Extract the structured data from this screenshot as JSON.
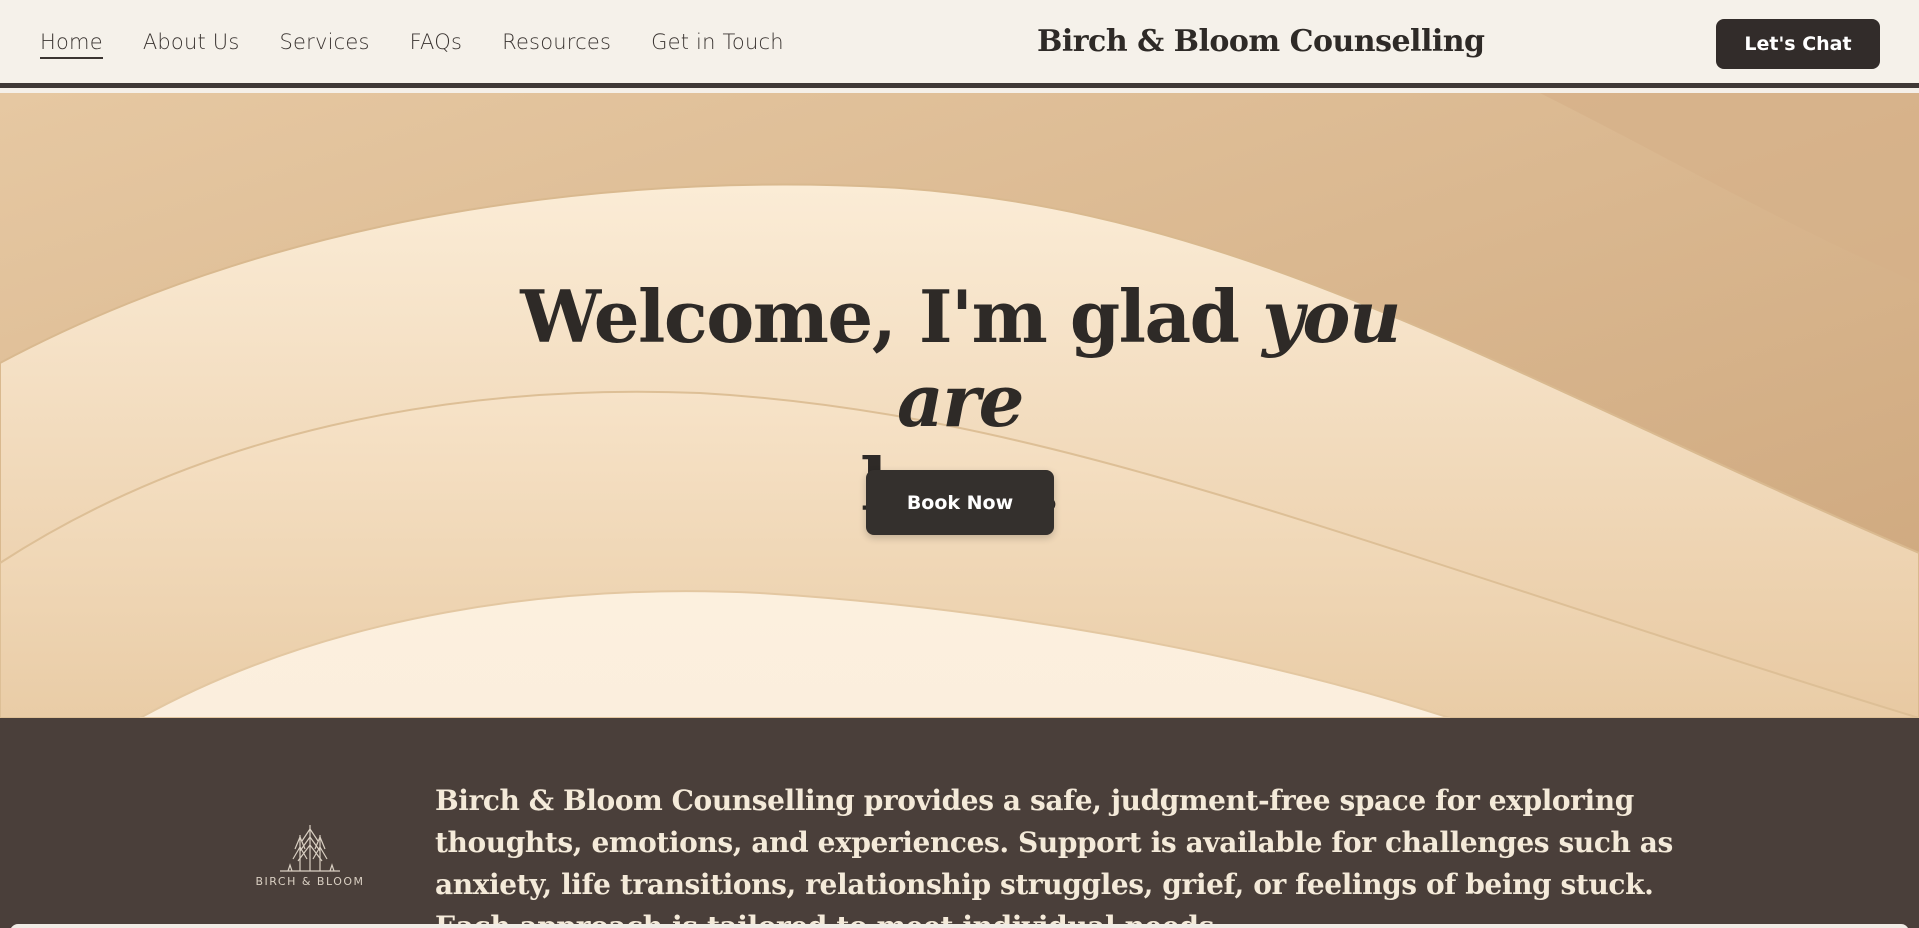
{
  "header": {
    "nav": [
      {
        "label": "Home",
        "active": true
      },
      {
        "label": "About Us"
      },
      {
        "label": "Services"
      },
      {
        "label": "FAQs"
      },
      {
        "label": "Resources"
      },
      {
        "label": "Get in Touch"
      }
    ],
    "brand": "Birch & Bloom Counselling",
    "chat_button": "Let's Chat"
  },
  "hero": {
    "title_line1_start": "Welcome, I'm glad ",
    "title_line1_emphasis": "you are",
    "title_line2": "here.",
    "book_button": "Book Now"
  },
  "about": {
    "logo_text": "BIRCH & BLOOM",
    "text": "Birch & Bloom Counselling provides a safe, judgment-free space for exploring thoughts, emotions, and experiences. Support is available for challenges such as anxiety, life transitions, relationship struggles, grief, or feelings of being stuck. Each approach is tailored to meet individual needs."
  },
  "colors": {
    "header_bg": "#f5f1ea",
    "dark_button": "#322c2a",
    "sand": "#dcbb93",
    "cream": "#fbeedd",
    "about_bg": "#4a3f3a"
  }
}
